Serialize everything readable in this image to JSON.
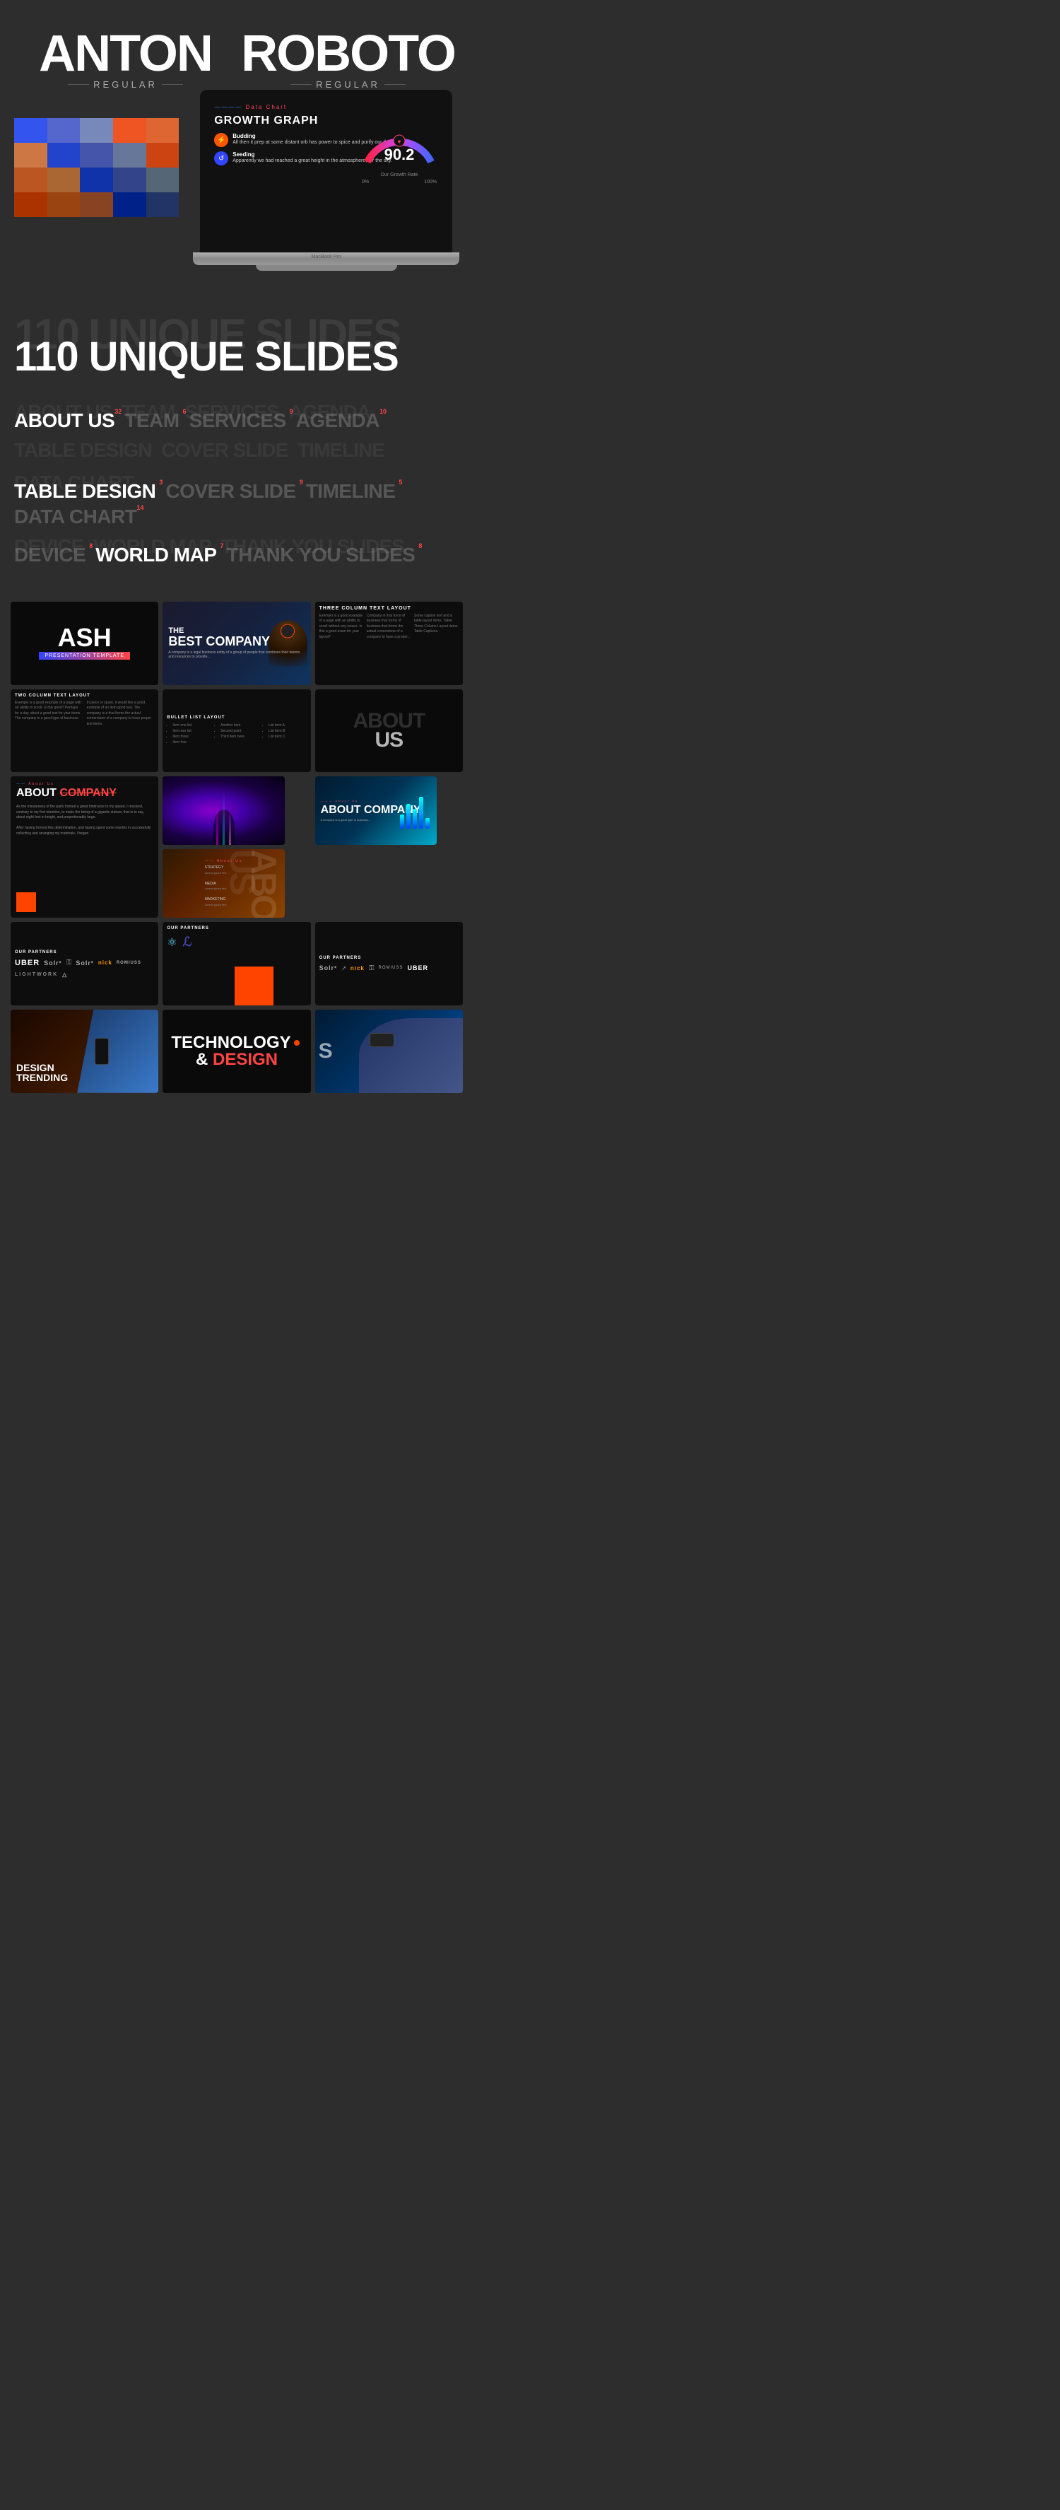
{
  "fonts": [
    {
      "name": "ANTON",
      "style": "REGULAR"
    },
    {
      "name": "ROBOTO",
      "style": "REGULAR"
    }
  ],
  "palette": {
    "colors": [
      [
        "#3355ee",
        "#5566cc",
        "#7788bb",
        "#ee5522",
        "#dd6633",
        "#cc7744"
      ],
      [
        "#2244cc",
        "#4455aa",
        "#667799",
        "#cc4411",
        "#bb5522",
        "#aa6633"
      ],
      [
        "#1133aa",
        "#334488",
        "#556677",
        "#aa3300",
        "#994411",
        "#884422"
      ],
      [
        "#002288",
        "#223366",
        "#445566",
        "#882200",
        "#773311",
        "#663322"
      ]
    ]
  },
  "laptop": {
    "slide": {
      "label_red": "Data Chart",
      "label_blue": "—————",
      "title": "GROWTH GRAPH",
      "items": [
        {
          "icon": "⚡",
          "title": "Budding",
          "text": "All then it prep at some distant orb has power to spice and purify our thoughts like."
        },
        {
          "icon": "↺",
          "title": "Seeding",
          "text": "Apparently we had reached a great height in the atmosphere, for the sky."
        }
      ],
      "gauge_value": "90.2",
      "gauge_label": "Our Growth Rate",
      "gauge_min": "0%",
      "gauge_max": "100%"
    },
    "model": "MacBook Pro"
  },
  "hero": {
    "bg_text": "110 UNIQUE SLIDES",
    "main_text": "110 UNIQUE SLIDES"
  },
  "categories": {
    "row1": [
      {
        "name": "ABOUT US",
        "count": "32",
        "bright": true
      },
      {
        "name": "TEAM",
        "count": "6",
        "bright": false
      },
      {
        "name": "SERVICES",
        "count": "9",
        "bright": false
      },
      {
        "name": "AGENDA",
        "count": "10",
        "bright": false
      }
    ],
    "row2": [
      {
        "name": "TABLE DESIGN",
        "count": "3",
        "bright": true
      },
      {
        "name": "COVER SLIDE",
        "count": "9",
        "bright": false
      },
      {
        "name": "TIMELINE",
        "count": "5",
        "bright": false
      },
      {
        "name": "DATA CHART",
        "count": "14",
        "bright": false
      }
    ],
    "row3": [
      {
        "name": "DEVICE",
        "count": "8",
        "bright": false
      },
      {
        "name": "WORLD MAP",
        "count": "7",
        "bright": true
      },
      {
        "name": "THANK YOU SLIDES",
        "count": "8",
        "bright": false
      }
    ]
  },
  "slides": {
    "row1": [
      {
        "type": "ash",
        "title": "ASH",
        "subtitle": "PRESENTATION TEMPLATE"
      },
      {
        "type": "best",
        "title": "THE",
        "title2": "BEST COMPANY"
      },
      {
        "type": "3col",
        "title": "THREE COLUMN TEXT LAYOUT"
      }
    ],
    "row2": [
      {
        "type": "2col",
        "title": "TWO COLUMN TEXT LAYOUT"
      },
      {
        "type": "bullet",
        "title": "BULLET LIST LAYOUT"
      },
      {
        "type": "aboutus",
        "title": "ABOUT US"
      }
    ],
    "row3_left": {
      "type": "aboutcomp",
      "title": "ABOUT COMPANY"
    },
    "row3_right_top": {
      "type": "aboutcomp2",
      "title": "ABOUT COMPANY"
    },
    "row3_right_bot": {
      "type": "aboutus2",
      "title": "ABOUT US"
    },
    "row3_center": {
      "type": "purple"
    },
    "row4": [
      {
        "type": "partners1",
        "title": "OUR PARTNERS"
      },
      {
        "type": "partners2",
        "title": "OUR PARTNERS"
      },
      {
        "type": "partners3",
        "title": "OUR PARTNERS"
      }
    ],
    "row5": [
      {
        "type": "design",
        "title": "DESIGN TRENDING"
      },
      {
        "type": "tech",
        "title": "TECHNOLOGY",
        "title2": "& DESIGN"
      },
      {
        "type": "vr"
      }
    ]
  }
}
